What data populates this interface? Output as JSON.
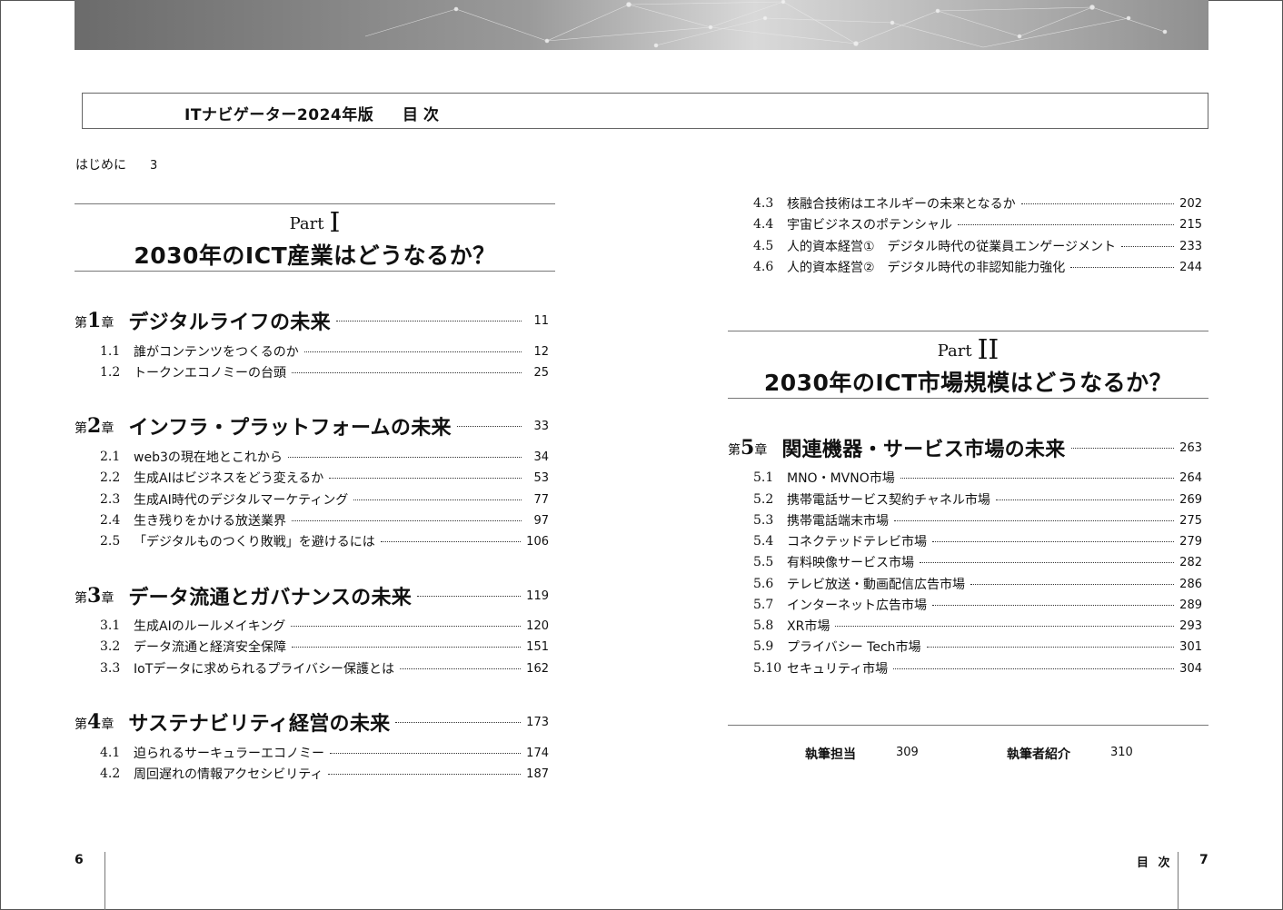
{
  "header": {
    "book_title": "ITナビゲーター2024年版",
    "toc_title": "目次"
  },
  "intro": {
    "label": "はじめに",
    "page": "3"
  },
  "parts": [
    {
      "label": "Part",
      "roman": "I",
      "title": "2030年のICT産業はどうなるか？"
    },
    {
      "label": "Part",
      "roman": "II",
      "title": "2030年のICT市場規模はどうなるか？"
    }
  ],
  "chapters": [
    {
      "prefix": "第",
      "num": "1",
      "suffix": "章",
      "title": "デジタルライフの未来",
      "page": "11",
      "sections": [
        {
          "num": "1.1",
          "title": "誰がコンテンツをつくるのか",
          "page": "12"
        },
        {
          "num": "1.2",
          "title": "トークンエコノミーの台頭",
          "page": "25"
        }
      ]
    },
    {
      "prefix": "第",
      "num": "2",
      "suffix": "章",
      "title": "インフラ・プラットフォームの未来",
      "page": "33",
      "sections": [
        {
          "num": "2.1",
          "title": "web3の現在地とこれから",
          "page": "34"
        },
        {
          "num": "2.2",
          "title": "生成AIはビジネスをどう変えるか",
          "page": "53"
        },
        {
          "num": "2.3",
          "title": "生成AI時代のデジタルマーケティング",
          "page": "77"
        },
        {
          "num": "2.4",
          "title": "生き残りをかける放送業界",
          "page": "97"
        },
        {
          "num": "2.5",
          "title": "「デジタルものつくり敗戦」を避けるには",
          "page": "106"
        }
      ]
    },
    {
      "prefix": "第",
      "num": "3",
      "suffix": "章",
      "title": "データ流通とガバナンスの未来",
      "page": "119",
      "sections": [
        {
          "num": "3.1",
          "title": "生成AIのルールメイキング",
          "page": "120"
        },
        {
          "num": "3.2",
          "title": "データ流通と経済安全保障",
          "page": "151"
        },
        {
          "num": "3.3",
          "title": "IoTデータに求められるプライバシー保護とは",
          "page": "162"
        }
      ]
    },
    {
      "prefix": "第",
      "num": "4",
      "suffix": "章",
      "title": "サステナビリティ経営の未来",
      "page": "173",
      "sections": [
        {
          "num": "4.1",
          "title": "迫られるサーキュラーエコノミー",
          "page": "174"
        },
        {
          "num": "4.2",
          "title": "周回遅れの情報アクセシビリティ",
          "page": "187"
        },
        {
          "num": "4.3",
          "title": "核融合技術はエネルギーの未来となるか",
          "page": "202"
        },
        {
          "num": "4.4",
          "title": "宇宙ビジネスのポテンシャル",
          "page": "215"
        },
        {
          "num": "4.5",
          "title": "人的資本経営①　デジタル時代の従業員エンゲージメント",
          "page": "233"
        },
        {
          "num": "4.6",
          "title": "人的資本経営②　デジタル時代の非認知能力強化",
          "page": "244"
        }
      ]
    },
    {
      "prefix": "第",
      "num": "5",
      "suffix": "章",
      "title": "関連機器・サービス市場の未来",
      "page": "263",
      "sections": [
        {
          "num": "5.1",
          "title": "MNO・MVNO市場",
          "page": "264"
        },
        {
          "num": "5.2",
          "title": "携帯電話サービス契約チャネル市場",
          "page": "269"
        },
        {
          "num": "5.3",
          "title": "携帯電話端末市場",
          "page": "275"
        },
        {
          "num": "5.4",
          "title": "コネクテッドテレビ市場",
          "page": "279"
        },
        {
          "num": "5.5",
          "title": "有料映像サービス市場",
          "page": "282"
        },
        {
          "num": "5.6",
          "title": "テレビ放送・動画配信広告市場",
          "page": "286"
        },
        {
          "num": "5.7",
          "title": "インターネット広告市場",
          "page": "289"
        },
        {
          "num": "5.8",
          "title": "XR市場",
          "page": "293"
        },
        {
          "num": "5.9",
          "title": "プライバシー Tech市場",
          "page": "301"
        },
        {
          "num": "5.10",
          "title": "セキュリティ市場",
          "page": "304"
        }
      ]
    }
  ],
  "back_matter": [
    {
      "label": "執筆担当",
      "page": "309"
    },
    {
      "label": "執筆者紹介",
      "page": "310"
    }
  ],
  "folio": {
    "left_page": "6",
    "right_label": "目 次",
    "right_page": "7"
  }
}
